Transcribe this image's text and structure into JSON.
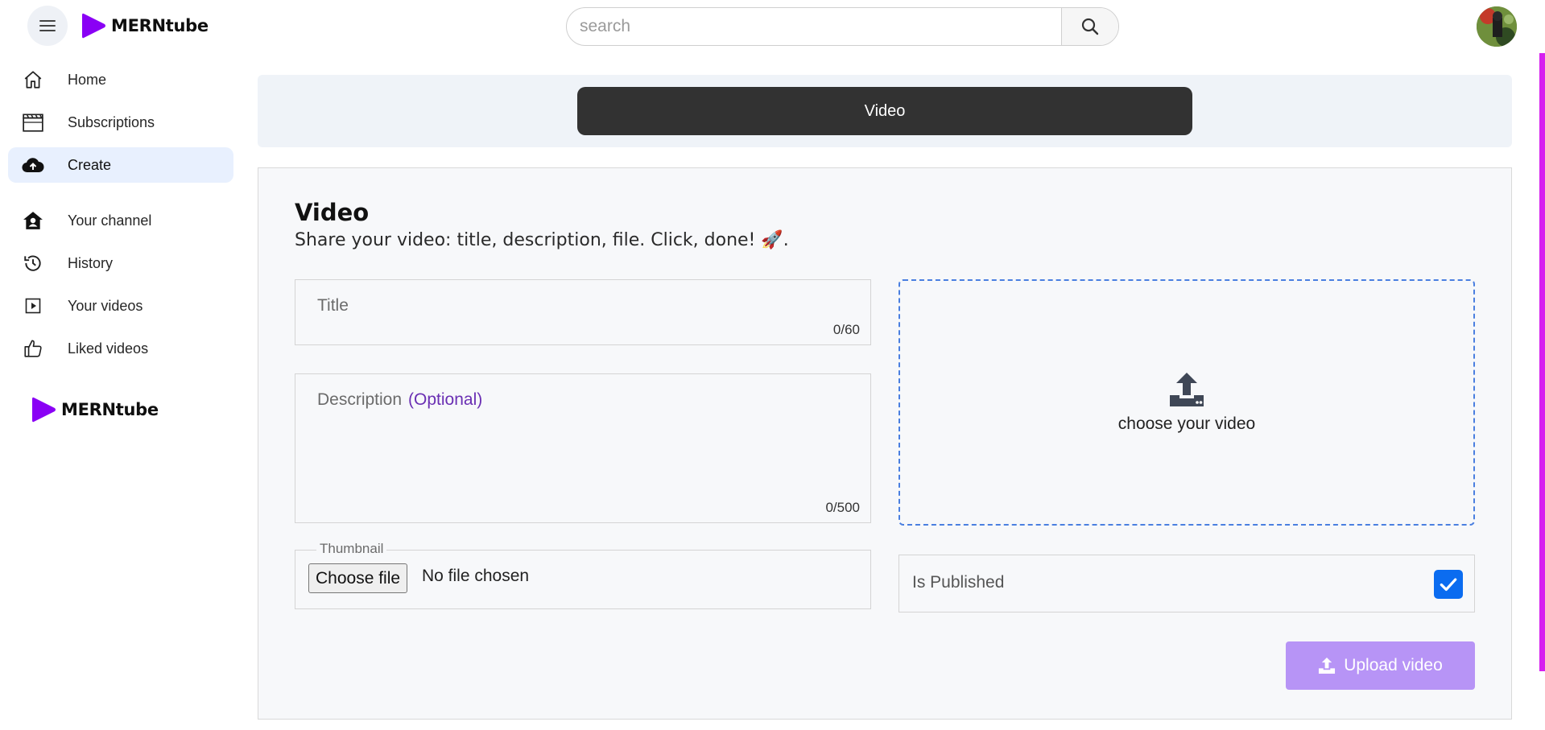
{
  "header": {
    "logo_text": "MERNtube",
    "search_placeholder": "search"
  },
  "sidebar": {
    "items": [
      {
        "label": "Home",
        "icon": "home-icon"
      },
      {
        "label": "Subscriptions",
        "icon": "clapperboard-icon"
      },
      {
        "label": "Create",
        "icon": "cloud-upload-icon",
        "active": true
      },
      {
        "label": "Your channel",
        "icon": "house-user-icon"
      },
      {
        "label": "History",
        "icon": "history-icon"
      },
      {
        "label": "Your videos",
        "icon": "play-square-icon"
      },
      {
        "label": "Liked videos",
        "icon": "thumbs-up-icon"
      }
    ],
    "logo_text": "MERNtube"
  },
  "tabs": {
    "video_label": "Video"
  },
  "form": {
    "title": "Video",
    "subtitle": "Share your video: title, description, file. Click, done! 🚀.",
    "title_field": {
      "placeholder": "Title",
      "counter": "0/60"
    },
    "description_field": {
      "placeholder": "Description",
      "optional": "(Optional)",
      "counter": "0/500"
    },
    "dropzone_label": "choose your video",
    "thumbnail": {
      "legend": "Thumbnail",
      "button": "Choose file",
      "status": "No file chosen"
    },
    "published": {
      "label": "Is Published",
      "checked": true
    },
    "upload_button": "Upload video"
  },
  "colors": {
    "brand": "#8a00f5",
    "accent_blue": "#0b6cf0",
    "upload_button": "#b794f6",
    "scroll_accent": "#d61ff0"
  }
}
